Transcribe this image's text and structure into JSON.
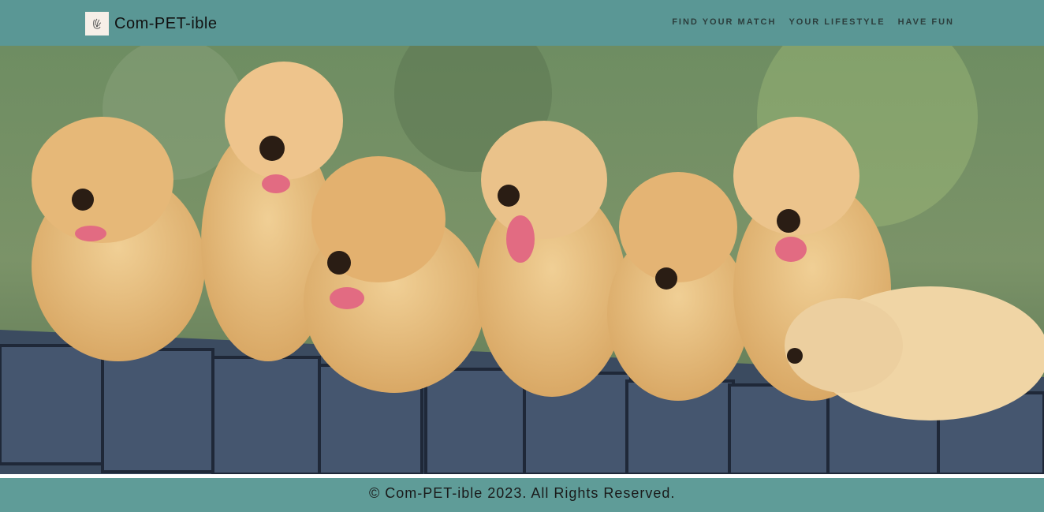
{
  "brand": {
    "name": "Com-PET-ible",
    "logo_icon": "paw-hand-icon"
  },
  "nav": {
    "items": [
      {
        "label": "FIND YOUR MATCH"
      },
      {
        "label": "YOUR LIFESTYLE"
      },
      {
        "label": "HAVE FUN"
      }
    ]
  },
  "hero": {
    "image": "golden-retriever-puppies-photo"
  },
  "footer": {
    "copyright": "© Com-PET-ible 2023. All Rights Reserved."
  },
  "colors": {
    "navbar": "#5a9795",
    "footer": "#5f9c98",
    "text": "#1a1a1a"
  }
}
